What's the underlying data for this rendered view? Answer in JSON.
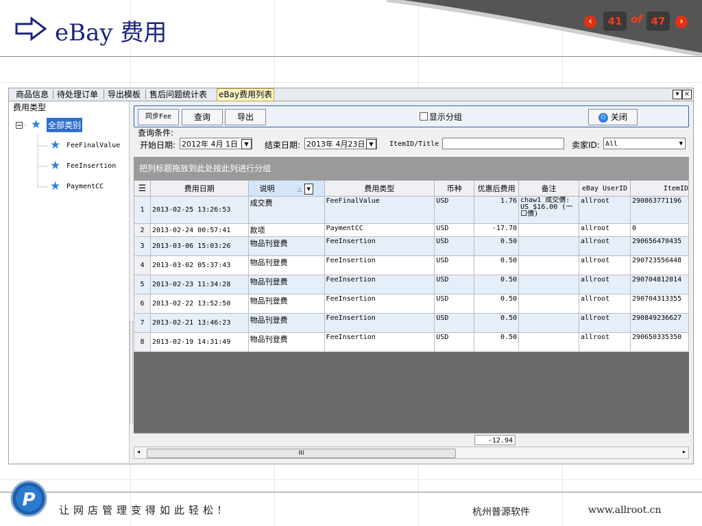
{
  "slide": {
    "title": "eBay 费用",
    "current_page": "41",
    "of_label": "of",
    "total_pages": "47",
    "prev_icon": "chevron-left-icon",
    "next_icon": "chevron-right-icon",
    "footer_slogan": "让网店管理变得如此轻松!",
    "footer_company": "杭州普源软件",
    "footer_site": "www.allroot.cn",
    "accent_color": "#1a237e",
    "nav_color": "#e53010"
  },
  "tabs": [
    {
      "label": "商品信息"
    },
    {
      "label": "待处理订单"
    },
    {
      "label": "导出模板"
    },
    {
      "label": "售后问题统计表"
    },
    {
      "label": "eBay费用列表"
    }
  ],
  "window_buttons": {
    "restore": "▾",
    "close": "×"
  },
  "left_panel": {
    "title": "费用类型",
    "root": "全部类别",
    "children": [
      "FeeFinalValue",
      "FeeInsertion",
      "PaymentCC"
    ]
  },
  "toolbar": {
    "sync": "同步Fee",
    "query": "查询",
    "export": "导出",
    "group_checkbox": "显示分组",
    "close": "关闭"
  },
  "query": {
    "section_label": "查询条件:",
    "start_label": "开始日期:",
    "start_value": "2012年 4月 1日",
    "end_label": "结束日期:",
    "end_value": "2013年 4月23日",
    "item_label": "ItemID/Title",
    "item_value": "",
    "seller_label": "卖家ID:",
    "seller_value": "All"
  },
  "group_hint": "把列标题拖放到此处按此列进行分组",
  "grid": {
    "headers": [
      "费用日期",
      "说明",
      "费用类型",
      "币种",
      "优惠后费用",
      "备注",
      "eBay UserID",
      "ItemID"
    ],
    "rows": [
      {
        "n": "1",
        "date": "2013-02-25 13:26:53",
        "desc": "成交费",
        "type": "FeeFinalValue",
        "cur": "USD",
        "fee": "1.76",
        "memo": "chaw1 成交價: US $16.00 (一口價)",
        "user": "allroot",
        "item": "290863771196"
      },
      {
        "n": "2",
        "date": "2013-02-24 00:57:41",
        "desc": "款项",
        "type": "PaymentCC",
        "cur": "USD",
        "fee": "-17.70",
        "memo": "",
        "user": "allroot",
        "item": "0"
      },
      {
        "n": "3",
        "date": "2013-03-06 15:03:26",
        "desc": "物品刊登费",
        "type": "FeeInsertion",
        "cur": "USD",
        "fee": "0.50",
        "memo": "",
        "user": "allroot",
        "item": "290656470435"
      },
      {
        "n": "4",
        "date": "2013-03-02 05:37:43",
        "desc": "物品刊登费",
        "type": "FeeInsertion",
        "cur": "USD",
        "fee": "0.50",
        "memo": "",
        "user": "allroot",
        "item": "290723556448"
      },
      {
        "n": "5",
        "date": "2013-02-23 11:34:28",
        "desc": "物品刊登费",
        "type": "FeeInsertion",
        "cur": "USD",
        "fee": "0.50",
        "memo": "",
        "user": "allroot",
        "item": "290704812014"
      },
      {
        "n": "6",
        "date": "2013-02-22 13:52:50",
        "desc": "物品刊登费",
        "type": "FeeInsertion",
        "cur": "USD",
        "fee": "0.50",
        "memo": "",
        "user": "allroot",
        "item": "290704313355"
      },
      {
        "n": "7",
        "date": "2013-02-21 13:46:23",
        "desc": "物品刊登费",
        "type": "FeeInsertion",
        "cur": "USD",
        "fee": "0.50",
        "memo": "",
        "user": "allroot",
        "item": "290849236627"
      },
      {
        "n": "8",
        "date": "2013-02-19 14:31:49",
        "desc": "物品刊登费",
        "type": "FeeInsertion",
        "cur": "USD",
        "fee": "0.50",
        "memo": "",
        "user": "allroot",
        "item": "290650335350"
      }
    ],
    "total_fee": "-12.94",
    "scroll_grip": "III"
  }
}
